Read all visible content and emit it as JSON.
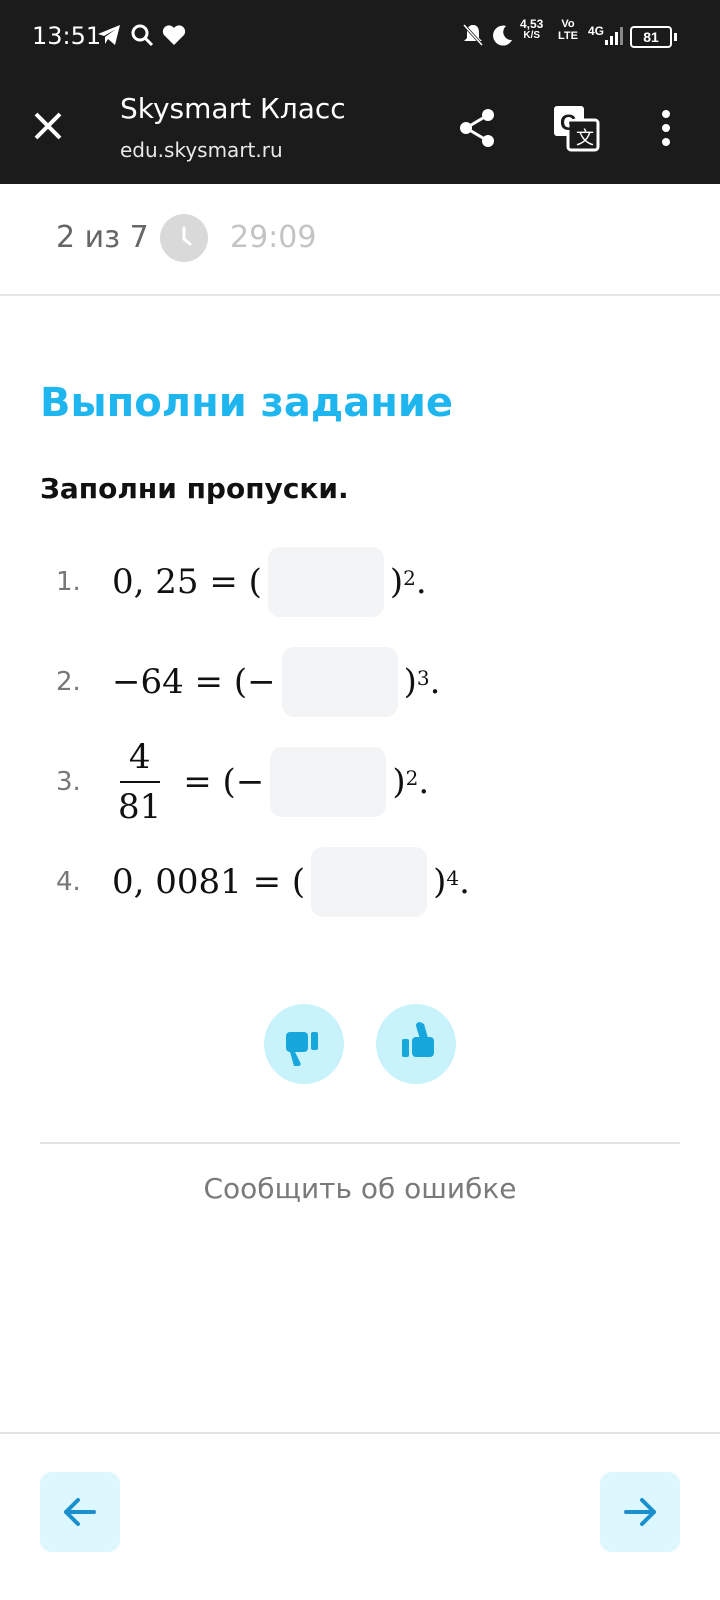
{
  "status": {
    "time": "13:51",
    "speed": "4,53",
    "speed_unit": "K/S",
    "volte_top": "Vo",
    "volte_bottom": "LTE",
    "net": "4G",
    "battery": "81"
  },
  "browser": {
    "title": "Skysmart Класс",
    "url": "edu.skysmart.ru"
  },
  "progress": {
    "counter": "2 из 7",
    "timer": "29:09"
  },
  "task": {
    "title": "Выполни задание",
    "instruction": "Заполни пропуски.",
    "items": [
      {
        "num": "1.",
        "lhs": "0, 25 = (",
        "exp": "2"
      },
      {
        "num": "2.",
        "lhs": "−64 = (−",
        "exp": "3"
      },
      {
        "num": "3.",
        "numerator": "4",
        "denominator": "81",
        "lhs": "= (−",
        "exp": "2"
      },
      {
        "num": "4.",
        "lhs": "0, 0081 = (",
        "exp": "4"
      }
    ]
  },
  "feedback": {
    "report": "Сообщить об ошибке"
  },
  "colors": {
    "accent": "#1fb6ef",
    "vote_bg": "#c8f3fb",
    "nav_bg": "#dcf7fd",
    "bar": "#1b1b1b"
  }
}
